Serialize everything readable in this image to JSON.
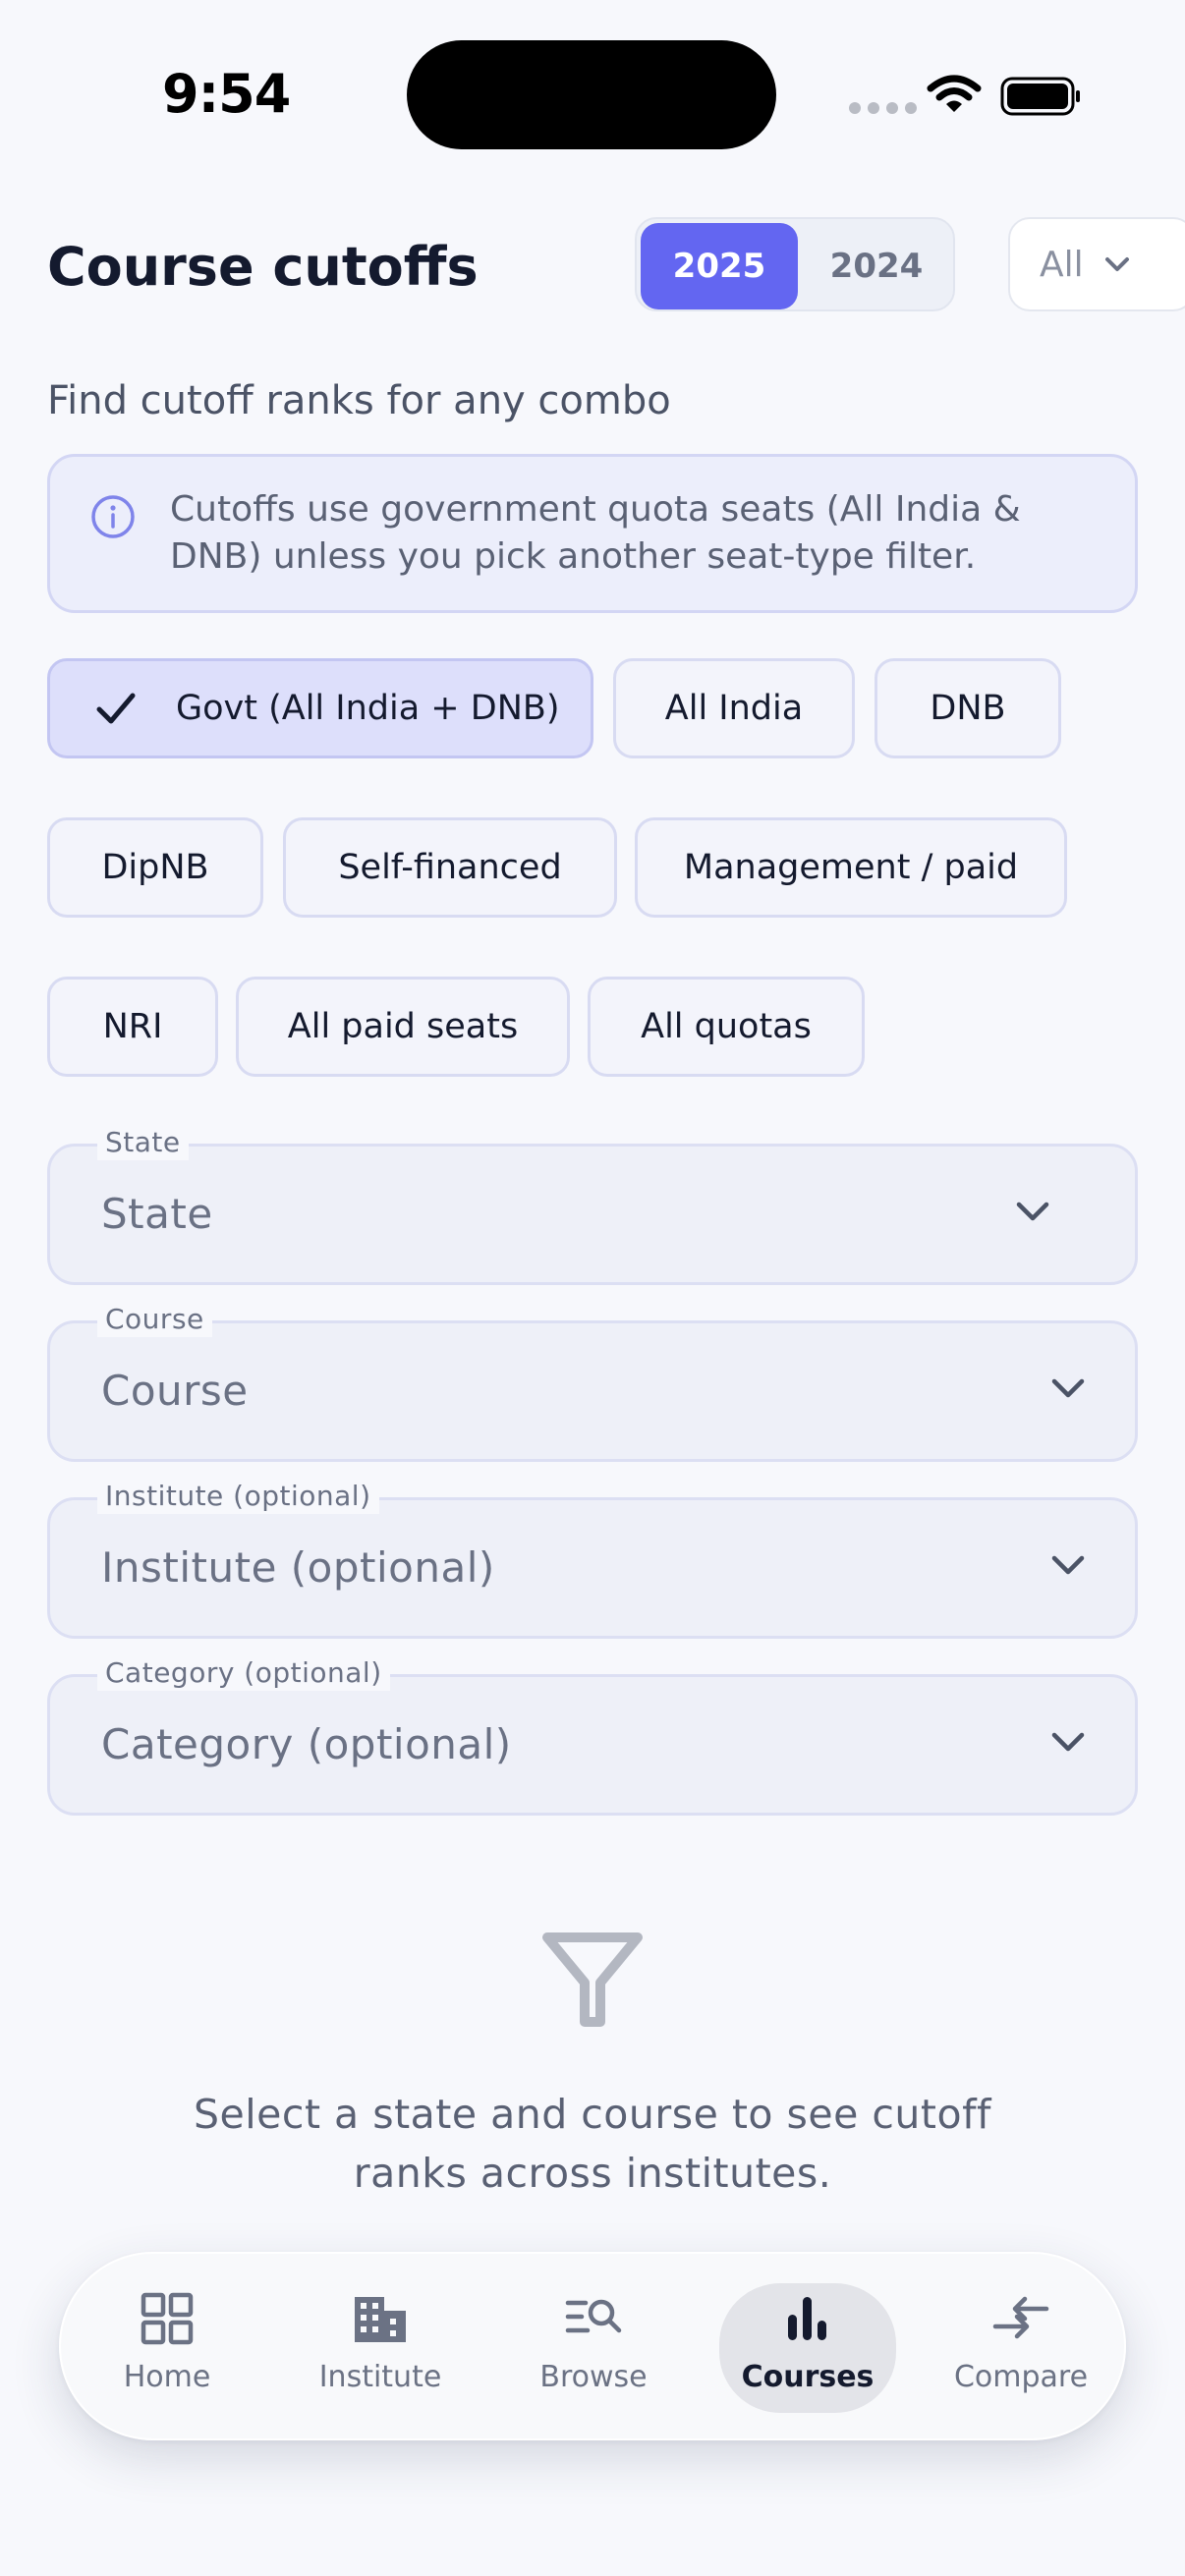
{
  "status_bar": {
    "time": "9:54"
  },
  "header": {
    "title": "Course cutoffs",
    "year_toggle": [
      "2025",
      "2024"
    ],
    "selected_year": "2025",
    "filter_value": "All"
  },
  "subtitle": "Find cutoff ranks for any combo",
  "info": {
    "text": "Cutoffs use government quota seats (All India & DNB) unless you pick another seat-type filter."
  },
  "chips": [
    {
      "label": "Govt (All India + DNB)",
      "selected": true
    },
    {
      "label": "All India"
    },
    {
      "label": "DNB"
    },
    {
      "label": "DipNB"
    },
    {
      "label": "Self-financed"
    },
    {
      "label": "Management / paid"
    },
    {
      "label": "NRI"
    },
    {
      "label": "All paid seats"
    },
    {
      "label": "All quotas"
    }
  ],
  "fields": [
    {
      "legend": "State",
      "placeholder": "State"
    },
    {
      "legend": "Course",
      "placeholder": "Course"
    },
    {
      "legend": "Institute (optional)",
      "placeholder": "Institute (optional)"
    },
    {
      "legend": "Category (optional)",
      "placeholder": "Category (optional)"
    }
  ],
  "empty_state": {
    "message": "Select a state and course to see cutoff ranks across institutes."
  },
  "nav": [
    {
      "label": "Home",
      "icon": "grid-icon"
    },
    {
      "label": "Institute",
      "icon": "building-icon"
    },
    {
      "label": "Browse",
      "icon": "browse-search-icon"
    },
    {
      "label": "Courses",
      "icon": "bar-chart-icon",
      "active": true
    },
    {
      "label": "Compare",
      "icon": "compare-arrows-icon"
    }
  ],
  "colors": {
    "accent": "#6366f1",
    "background": "#f7f8fc",
    "text": "#141a2e"
  }
}
